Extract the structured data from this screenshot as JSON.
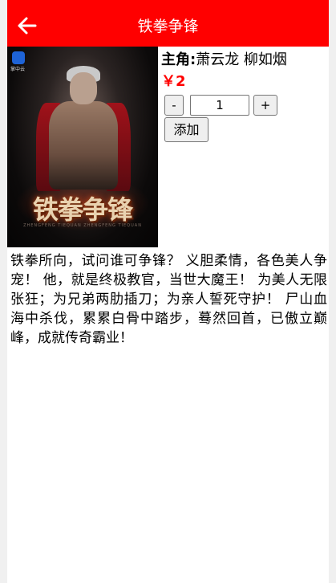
{
  "header": {
    "title": "铁拳争锋",
    "back_icon": "arrow-left-icon"
  },
  "product": {
    "cover": {
      "app_label": "掌中云",
      "cover_title": "铁拳争锋",
      "cover_subtitle": "ZHENGFENG TIEQUAN ZHENGFENG TIEQUAN"
    },
    "lead_label": "主角:",
    "lead_names": "萧云龙 柳如烟",
    "price": "￥2",
    "quantity": {
      "minus_label": "-",
      "value": "1",
      "plus_label": "+"
    },
    "add_label": "添加",
    "description": "铁拳所向，试问谁可争锋？ 义胆柔情，各色美人争宠！ 他，就是终极教官，当世大魔王！ 为美人无限张狂；为兄弟两肋插刀；为亲人誓死守护！ 尸山血海中杀伐，累累白骨中踏步，蓦然回首，已傲立巅峰，成就传奇霸业！"
  },
  "colors": {
    "header_bg": "#ff0000",
    "price": "#ff0000",
    "page_bg": "#f0f0f0"
  }
}
